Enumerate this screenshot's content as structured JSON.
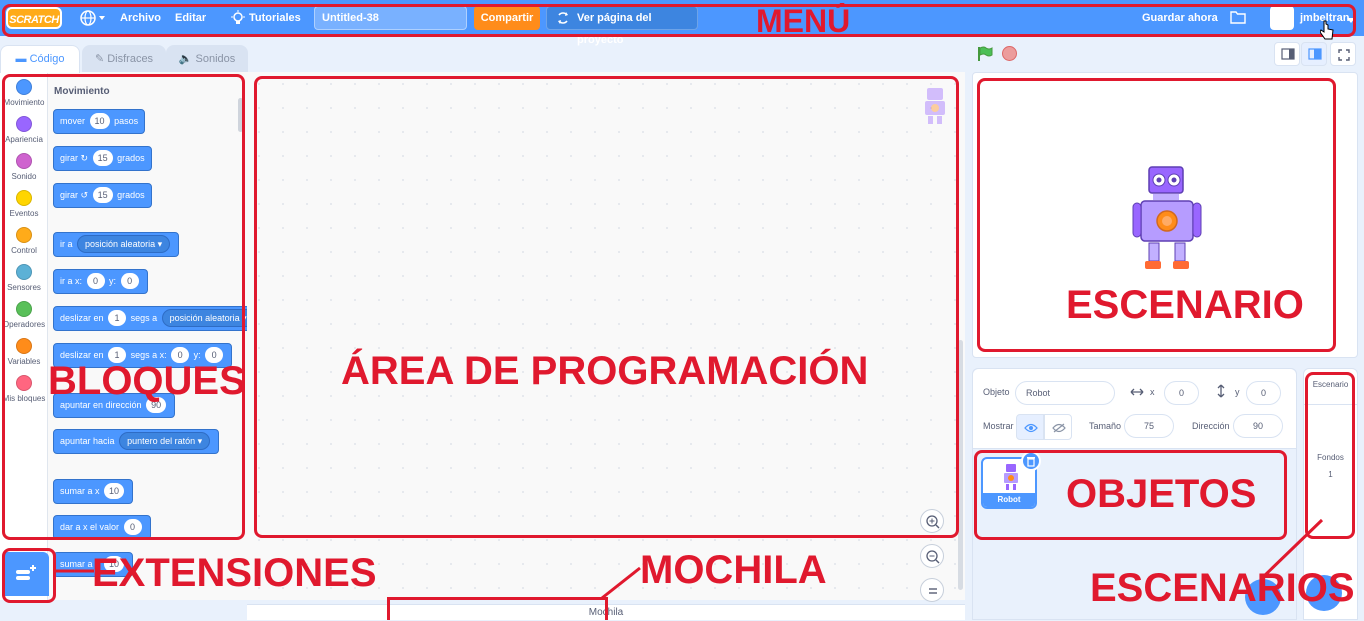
{
  "menu": {
    "logo": "SCRATCH",
    "file": "Archivo",
    "edit": "Editar",
    "tutorials": "Tutoriales",
    "project_title": "Untitled-38",
    "share": "Compartir",
    "see_project": "Ver página del proyecto",
    "save_now": "Guardar ahora",
    "username": "jmbeltran"
  },
  "tabs": {
    "code": "Código",
    "costumes": "Disfraces",
    "sounds": "Sonidos"
  },
  "categories": [
    {
      "label": "Movimiento",
      "color": "#4c97ff"
    },
    {
      "label": "Apariencia",
      "color": "#9966ff"
    },
    {
      "label": "Sonido",
      "color": "#cf63cf"
    },
    {
      "label": "Eventos",
      "color": "#ffd500"
    },
    {
      "label": "Control",
      "color": "#ffab19"
    },
    {
      "label": "Sensores",
      "color": "#5cb1d6"
    },
    {
      "label": "Operadores",
      "color": "#59c059"
    },
    {
      "label": "Variables",
      "color": "#ff8c1a"
    },
    {
      "label": "Mis bloques",
      "color": "#ff6680"
    }
  ],
  "palette": {
    "section_title": "Movimiento",
    "blocks": {
      "move": {
        "pre": "mover",
        "value": "10",
        "post": "pasos"
      },
      "turn_right": {
        "pre": "girar",
        "value": "15",
        "post": "grados"
      },
      "turn_left": {
        "pre": "girar",
        "value": "15",
        "post": "grados"
      },
      "goto": {
        "pre": "ir a",
        "menu": "posición aleatoria"
      },
      "goto_xy": {
        "pre": "ir a x:",
        "x": "0",
        "mid": "y:",
        "y": "0"
      },
      "glide_to": {
        "pre": "deslizar en",
        "value": "1",
        "mid": "segs a",
        "menu": "posición aleatoria"
      },
      "glide_xy": {
        "pre": "deslizar en",
        "value": "1",
        "mid": "segs a x:",
        "x": "0",
        "mid2": "y:",
        "y": "0"
      },
      "point_dir": {
        "pre": "apuntar en dirección",
        "value": "90"
      },
      "point_towards": {
        "pre": "apuntar hacia",
        "menu": "puntero del ratón"
      },
      "change_x": {
        "pre": "sumar a x",
        "value": "10"
      },
      "set_x": {
        "pre": "dar a x el valor",
        "value": "0"
      },
      "change_y": {
        "pre": "sumar a y",
        "value": "10"
      }
    }
  },
  "backpack": "Mochila",
  "sprite_info": {
    "sprite_label": "Objeto",
    "sprite_name": "Robot",
    "x_label": "x",
    "x_value": "0",
    "y_label": "y",
    "y_value": "0",
    "show_label": "Mostrar",
    "size_label": "Tamaño",
    "size_value": "75",
    "direction_label": "Dirección",
    "direction_value": "90"
  },
  "sprites": [
    {
      "name": "Robot"
    }
  ],
  "stage_pane": {
    "title": "Escenario",
    "backdrops_label": "Fondos",
    "backdrops_count": "1"
  },
  "annotations": {
    "menu": "MENÚ",
    "stage": "ESCENARIO",
    "programming_area": "ÁREA DE PROGRAMACIÓN",
    "blocks": "BLOQUES",
    "sprites": "OBJETOS",
    "extensions": "EXTENSIONES",
    "backpack": "MOCHILA",
    "backdrops": "ESCENARIOS"
  },
  "colors": {
    "menu_bar": "#4c97ff",
    "annotation": "#e0192e",
    "share": "#ff8c1a",
    "motion": "#4c97ff"
  }
}
